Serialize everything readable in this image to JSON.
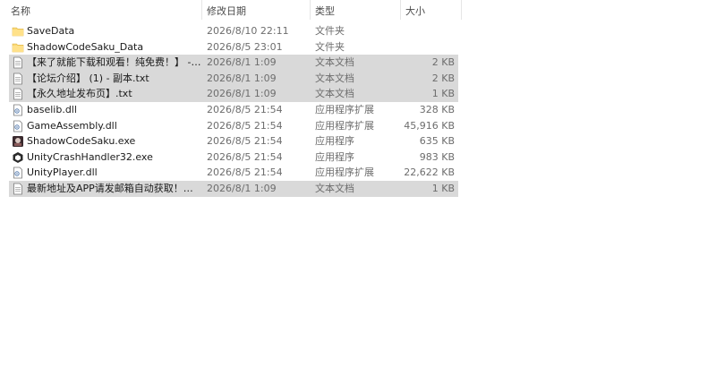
{
  "columns": {
    "name": "名称",
    "date": "修改日期",
    "type": "类型",
    "size": "大小"
  },
  "files": [
    {
      "name": "SaveData",
      "date": "2026/8/10 22:11",
      "type": "文件夹",
      "size": "",
      "icon": "folder-icon",
      "selected": false
    },
    {
      "name": "ShadowCodeSaku_Data",
      "date": "2026/8/5 23:01",
      "type": "文件夹",
      "size": "",
      "icon": "folder-icon",
      "selected": false
    },
    {
      "name": "【来了就能下载和观看！纯免费！】 - 副...",
      "date": "2026/8/1 1:09",
      "type": "文本文档",
      "size": "2 KB",
      "icon": "text-file-icon",
      "selected": true
    },
    {
      "name": "【论坛介绍】 (1) - 副本.txt",
      "date": "2026/8/1 1:09",
      "type": "文本文档",
      "size": "2 KB",
      "icon": "text-file-icon",
      "selected": true
    },
    {
      "name": "【永久地址发布页】.txt",
      "date": "2026/8/1 1:09",
      "type": "文本文档",
      "size": "1 KB",
      "icon": "text-file-icon",
      "selected": true
    },
    {
      "name": "baselib.dll",
      "date": "2026/8/5 21:54",
      "type": "应用程序扩展",
      "size": "328 KB",
      "icon": "dll-file-icon",
      "selected": false
    },
    {
      "name": "GameAssembly.dll",
      "date": "2026/8/5 21:54",
      "type": "应用程序扩展",
      "size": "45,916 KB",
      "icon": "dll-file-icon",
      "selected": false
    },
    {
      "name": "ShadowCodeSaku.exe",
      "date": "2026/8/5 21:54",
      "type": "应用程序",
      "size": "635 KB",
      "icon": "game-exe-icon",
      "selected": false
    },
    {
      "name": "UnityCrashHandler32.exe",
      "date": "2026/8/5 21:54",
      "type": "应用程序",
      "size": "983 KB",
      "icon": "unity-exe-icon",
      "selected": false
    },
    {
      "name": "UnityPlayer.dll",
      "date": "2026/8/5 21:54",
      "type": "应用程序扩展",
      "size": "22,622 KB",
      "icon": "dll-file-icon",
      "selected": false
    },
    {
      "name": "最新地址及APP请发邮箱自动获取！！！...",
      "date": "2026/8/1 1:09",
      "type": "文本文档",
      "size": "1 KB",
      "icon": "text-file-icon",
      "selected": true
    }
  ]
}
